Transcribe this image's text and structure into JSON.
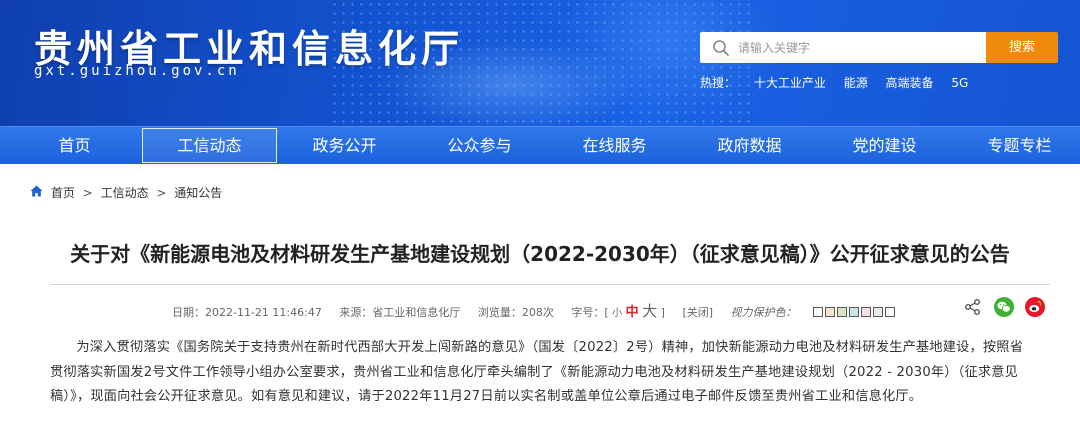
{
  "header": {
    "site_title": "贵州省工业和信息化厅",
    "site_domain": "gxt.guizhou.gov.cn",
    "search": {
      "placeholder": "请输入关键字",
      "button_label": "搜索"
    },
    "hot_label": "热搜：",
    "hot_links": [
      "十大工业产业",
      "能源",
      "高端装备",
      "5G"
    ]
  },
  "nav": {
    "items": [
      "首页",
      "工信动态",
      "政务公开",
      "公众参与",
      "在线服务",
      "政府数据",
      "党的建设",
      "专题专栏"
    ],
    "active": "工信动态"
  },
  "breadcrumb": {
    "items": [
      "首页",
      "工信动态",
      "通知公告"
    ],
    "separator": ">"
  },
  "article": {
    "title": "关于对《新能源电池及材料研发生产基地建设规划（2022-2030年）（征求意见稿）》公开征求意见的公告",
    "meta": {
      "date": "日期：2022-11-21 11:46:47",
      "source": "来源：省工业和信息化厅",
      "views": "浏览量：208次",
      "font_size_label": "字号：",
      "font_size_open": "[",
      "font_small": "小",
      "font_mid": "中",
      "font_big": "大",
      "font_size_close": "]",
      "close_label": "[关闭]",
      "vision_label": "视力保护色："
    },
    "vision_colors": [
      "#ffffff",
      "#f5e6c8",
      "#d8e6c4",
      "#cfe0f0",
      "#f0e0f0",
      "#e8e8e8",
      "#ffffff"
    ],
    "body": "为深入贯彻落实《国务院关于支持贵州在新时代西部大开发上闯新路的意见》（国发〔2022〕2号）精神，加快新能源动力电池及材料研发生产基地建设，按照省贯彻落实新国发2号文件工作领导小组办公室要求，贵州省工业和信息化厅牵头编制了《新能源动力电池及材料研发生产基地建设规划（2022 - 2030年）（征求意见稿）》，现面向社会公开征求意见。如有意见和建议，请于2022年11月27日前以实名制或盖单位公章后通过电子邮件反馈至贵州省工业和信息化厅。"
  },
  "colors": {
    "header_blue": "#1456d4",
    "nav_blue": "#2f77ea",
    "search_orange": "#f08a0c",
    "wechat_green": "#3cb035",
    "weibo_red": "#e6162d"
  }
}
